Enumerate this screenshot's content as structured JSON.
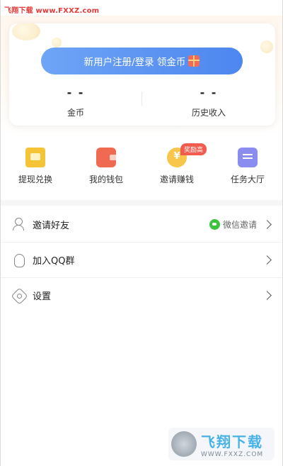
{
  "watermark": {
    "top_text": "飞翔下载 www.FXXZ.com"
  },
  "account_card": {
    "login_button_label": "新用户注册/登录 领金币",
    "stats": [
      {
        "value": "- -",
        "label": "金币"
      },
      {
        "value": "- -",
        "label": "历史收入"
      }
    ]
  },
  "quick_actions": [
    {
      "label": "提现兑换",
      "icon": "withdraw-icon"
    },
    {
      "label": "我的钱包",
      "icon": "wallet-icon"
    },
    {
      "label": "邀请赚钱",
      "icon": "coin-icon",
      "badge": "奖励高"
    },
    {
      "label": "任务大厅",
      "icon": "task-icon"
    }
  ],
  "menu": [
    {
      "label": "邀请好友",
      "right_text": "微信邀请",
      "icon": "user-add-icon"
    },
    {
      "label": "加入QQ群",
      "icon": "qq-icon"
    },
    {
      "label": "设置",
      "icon": "gear-icon"
    }
  ],
  "bottom_watermark": {
    "title": "飞翔下载",
    "url": "WWW.FXXZ.COM"
  },
  "colors": {
    "primary_blue": "#5b93f1",
    "badge_red": "#f25b4e",
    "wechat_green": "#3cc43f"
  }
}
